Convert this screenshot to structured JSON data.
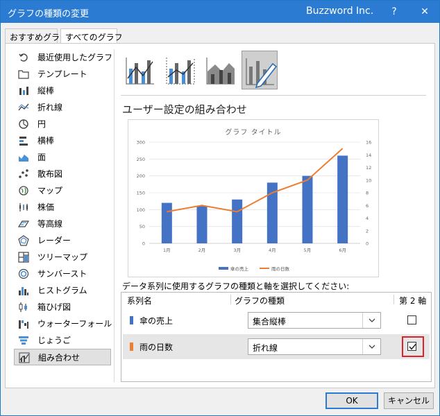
{
  "window": {
    "title": "グラフの種類の変更",
    "company": "Buzzword Inc.",
    "help": "?",
    "close": "✕"
  },
  "tabs": [
    {
      "label": "おすすめグラフ"
    },
    {
      "label": "すべてのグラフ"
    }
  ],
  "sidebar": {
    "items": [
      {
        "label": "最近使用したグラフ",
        "icon": "recent-icon"
      },
      {
        "label": "テンプレート",
        "icon": "folder-icon"
      },
      {
        "label": "縦棒",
        "icon": "column-chart-icon"
      },
      {
        "label": "折れ線",
        "icon": "line-chart-icon"
      },
      {
        "label": "円",
        "icon": "pie-chart-icon"
      },
      {
        "label": "横棒",
        "icon": "bar-chart-icon"
      },
      {
        "label": "面",
        "icon": "area-chart-icon"
      },
      {
        "label": "散布図",
        "icon": "scatter-chart-icon"
      },
      {
        "label": "マップ",
        "icon": "map-chart-icon"
      },
      {
        "label": "株価",
        "icon": "stock-chart-icon"
      },
      {
        "label": "等高線",
        "icon": "surface-chart-icon"
      },
      {
        "label": "レーダー",
        "icon": "radar-chart-icon"
      },
      {
        "label": "ツリーマップ",
        "icon": "treemap-icon"
      },
      {
        "label": "サンバースト",
        "icon": "sunburst-icon"
      },
      {
        "label": "ヒストグラム",
        "icon": "histogram-icon"
      },
      {
        "label": "箱ひげ図",
        "icon": "boxplot-icon"
      },
      {
        "label": "ウォーターフォール",
        "icon": "waterfall-icon"
      },
      {
        "label": "じょうご",
        "icon": "funnel-icon"
      },
      {
        "label": "組み合わせ",
        "icon": "combo-chart-icon"
      }
    ]
  },
  "section_title": "ユーザー設定の組み合わせ",
  "chart_data": {
    "type": "bar",
    "title": "グラフ タイトル",
    "categories": [
      "1月",
      "2月",
      "3月",
      "4月",
      "5月",
      "6月"
    ],
    "series": [
      {
        "name": "傘の売上",
        "type": "bar",
        "axis": "primary",
        "color": "#4472c4",
        "values": [
          120,
          110,
          130,
          180,
          200,
          260
        ]
      },
      {
        "name": "雨の日数",
        "type": "line",
        "axis": "secondary",
        "color": "#ed7d31",
        "values": [
          5,
          6,
          5,
          8,
          10,
          15
        ]
      }
    ],
    "y_left_ticks": [
      "0",
      "50",
      "100",
      "150",
      "200",
      "250",
      "300"
    ],
    "y_right_ticks": [
      "0",
      "2",
      "4",
      "6",
      "8",
      "10",
      "12",
      "14",
      "16"
    ],
    "ylim": [
      0,
      300
    ],
    "y2lim": [
      0,
      16
    ],
    "grid": true,
    "legend": "bottom"
  },
  "instruction": "データ系列に使用するグラフの種類と軸を選択してください:",
  "grid": {
    "col_series": "系列名",
    "col_type": "グラフの種類",
    "col_axis": "第 2 軸",
    "rows": [
      {
        "name": "傘の売上",
        "type": "集合縦棒",
        "color": "#4472c4",
        "secondary": false
      },
      {
        "name": "雨の日数",
        "type": "折れ線",
        "color": "#ed7d31",
        "secondary": true
      }
    ]
  },
  "buttons": {
    "ok": "OK",
    "cancel": "キャンセル"
  }
}
